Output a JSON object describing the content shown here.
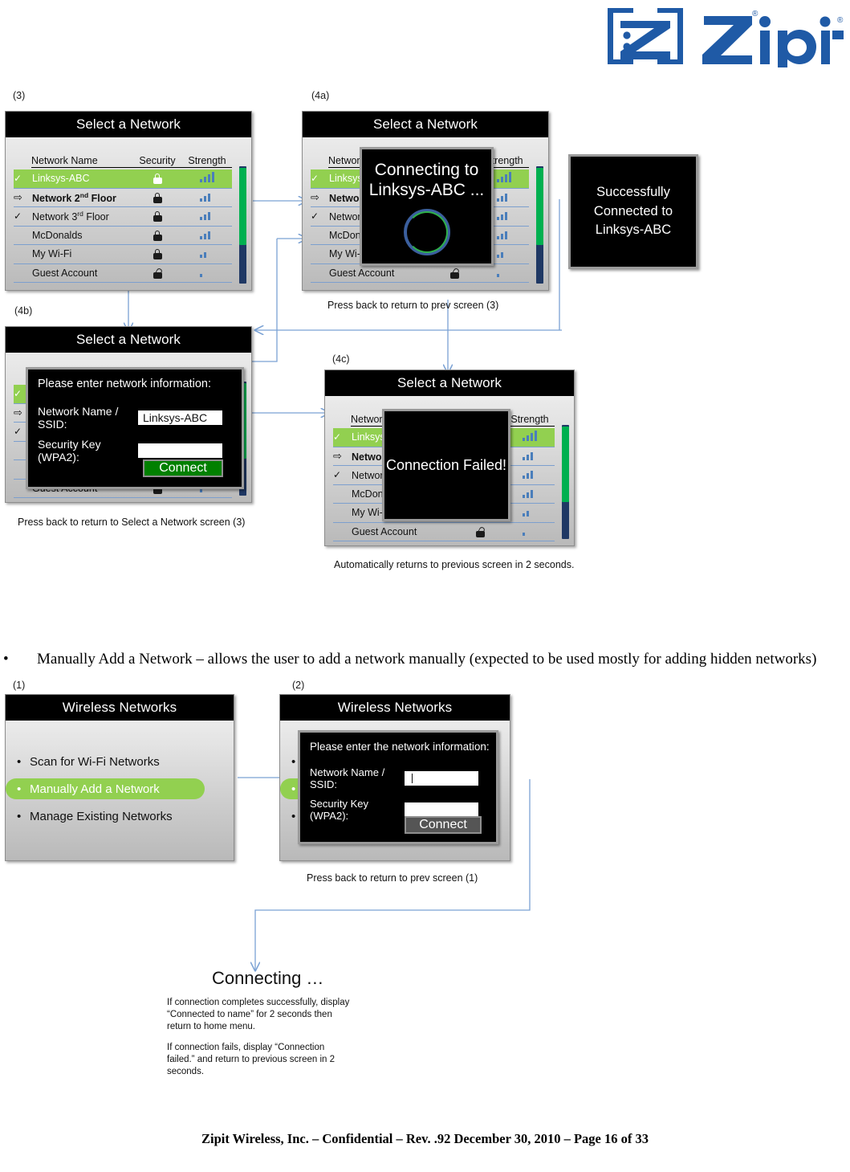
{
  "brand": {
    "name": "Zipit",
    "registered": "®"
  },
  "steps": {
    "s3": "(3)",
    "s4a": "(4a)",
    "s4b": "(4b)",
    "s4c": "(4c)",
    "s1": "(1)",
    "s2": "(2)"
  },
  "select_network": {
    "title": "Select a Network",
    "columns": {
      "name": "Network Name",
      "security": "Security",
      "strength": "Strength"
    },
    "rows": [
      {
        "name": "Linksys-ABC",
        "marker": "check",
        "selected": true,
        "bold": false,
        "lock": "closed",
        "bars": 4,
        "sup": ""
      },
      {
        "name": "Network 2",
        "sup": "nd",
        "name_tail": " Floor",
        "marker": "arrow",
        "selected": false,
        "bold": true,
        "lock": "closed",
        "bars": 3
      },
      {
        "name": "Network 3",
        "sup": "rd",
        "name_tail": " Floor",
        "marker": "check",
        "selected": false,
        "bold": false,
        "lock": "closed",
        "bars": 3
      },
      {
        "name": "McDonalds",
        "marker": "",
        "selected": false,
        "bold": false,
        "lock": "closed",
        "bars": 3,
        "sup": ""
      },
      {
        "name": "My Wi-Fi",
        "marker": "",
        "selected": false,
        "bold": false,
        "lock": "closed",
        "bars": 2,
        "sup": ""
      },
      {
        "name": "Guest Account",
        "marker": "",
        "selected": false,
        "bold": false,
        "lock": "open",
        "bars": 1,
        "sup": ""
      }
    ]
  },
  "connecting_overlay": {
    "line1": "Connecting to",
    "line2": "Linksys-ABC ..."
  },
  "success_box": {
    "line1": "Successfully",
    "line2": "Connected to",
    "line3": "Linksys-ABC"
  },
  "failed_overlay": {
    "text": "Connection Failed!"
  },
  "network_form_4b": {
    "prompt": "Please enter network information:",
    "ssid_label": "Network Name / SSID:",
    "ssid_value": "Linksys-ABC",
    "key_label": "Security Key (WPA2):",
    "key_value": "",
    "connect_label": "Connect"
  },
  "network_form_2": {
    "prompt": "Please enter the network information:",
    "ssid_label": "Network Name / SSID:",
    "ssid_value": "",
    "key_label": "Security Key (WPA2):",
    "key_value": "",
    "connect_label": "Connect"
  },
  "captions": {
    "c4a": "Press back to return to prev screen (3)",
    "c4b": "Press back to return to Select a Network screen (3)",
    "c4c": "Automatically returns to previous screen in 2 seconds.",
    "c2": "Press back to return to prev screen (1)"
  },
  "bullet": {
    "marker": "•",
    "text": "Manually Add a Network – allows the user to add a network manually (expected to be used mostly for adding hidden networks)"
  },
  "wireless_menu": {
    "title": "Wireless Networks",
    "items": [
      {
        "label": "Scan for Wi-Fi Networks",
        "highlight": false
      },
      {
        "label": "Manually Add a Network",
        "highlight": true
      },
      {
        "label": "Manage Existing Networks",
        "highlight": false
      }
    ]
  },
  "connecting_final": {
    "heading": "Connecting …",
    "note1": "If connection completes successfully, display “Connected to name” for 2 seconds then return to home menu.",
    "note2": "If connection fails, display “Connection failed.” and return to previous screen in 2 seconds."
  },
  "footer": "Zipit Wireless, Inc. – Confidential – Rev. .92 December 30, 2010 – Page 16 of 33",
  "colors": {
    "brand_blue": "#1f5aa6",
    "highlight_green": "#92d050",
    "connect_green": "#018000",
    "connector_blue": "#7ba2d4",
    "scroll_green": "#00b050",
    "scroll_track": "#1f3864",
    "bar_blue": "#4a7ebb"
  }
}
